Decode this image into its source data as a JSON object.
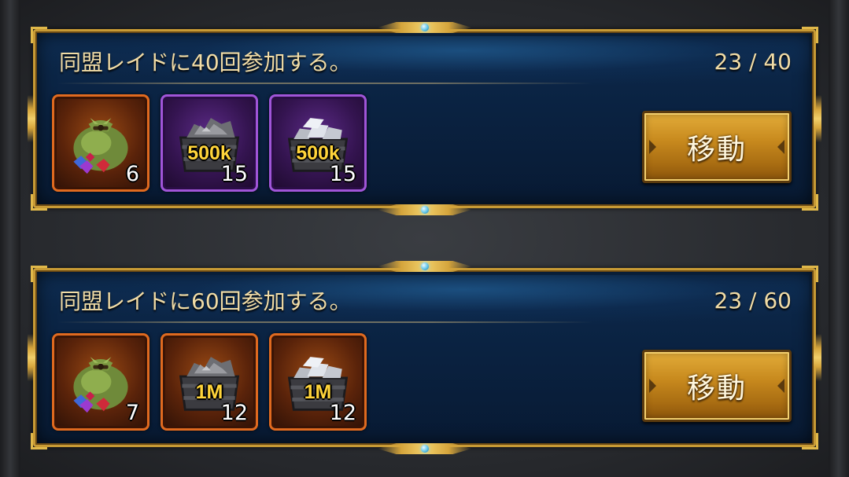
{
  "quests": [
    {
      "title": "同盟レイドに40回参加する。",
      "progress": "23 / 40",
      "button_label": "移動",
      "rewards": [
        {
          "icon": "gem-bag-icon",
          "amount": "",
          "count": "6",
          "frame": "orange"
        },
        {
          "icon": "ore-cart-icon",
          "amount": "500k",
          "count": "15",
          "frame": "purple"
        },
        {
          "icon": "silver-ingot-cart-icon",
          "amount": "500k",
          "count": "15",
          "frame": "purple"
        }
      ]
    },
    {
      "title": "同盟レイドに60回参加する。",
      "progress": "23 / 60",
      "button_label": "移動",
      "rewards": [
        {
          "icon": "gem-bag-icon",
          "amount": "",
          "count": "7",
          "frame": "orange"
        },
        {
          "icon": "ore-cart-icon",
          "amount": "1M",
          "count": "12",
          "frame": "orange"
        },
        {
          "icon": "silver-ingot-cart-icon",
          "amount": "1M",
          "count": "12",
          "frame": "orange"
        }
      ]
    }
  ],
  "colors": {
    "panel_bg": "#0b2545",
    "frame_gold": "#c79a35",
    "title_text": "#f1dca6",
    "amount_text": "#ffd43a",
    "button_gold": "#c88a1e"
  }
}
